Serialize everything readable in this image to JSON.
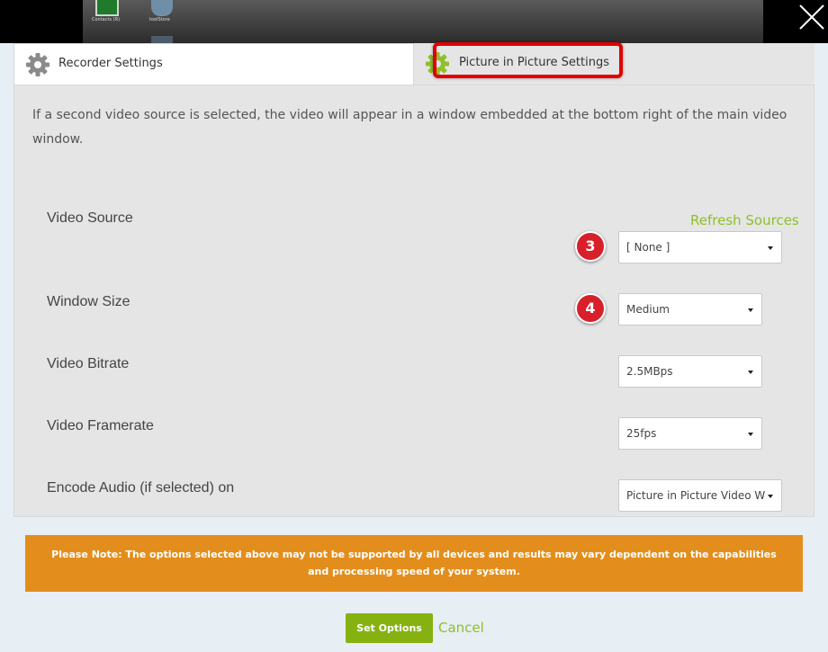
{
  "close_icon": "close-icon",
  "background": {
    "icons": [
      {
        "name": "green-app-icon",
        "caption": "Contacts (R)"
      },
      {
        "name": "cloud-app-icon",
        "caption": "toolStore"
      }
    ]
  },
  "tabs": [
    {
      "label": "Recorder Settings",
      "icon": "gear-icon",
      "active": true
    },
    {
      "label": "Picture in Picture Settings",
      "icon": "gear-icon",
      "active": false,
      "highlighted": true
    }
  ],
  "intro": "If a second video source is selected, the video will appear in a window embedded at the bottom right of the main video window.",
  "refresh_label": "Refresh Sources",
  "fields": [
    {
      "label": "Video Source",
      "value": "[ None ]",
      "marker": "3"
    },
    {
      "label": "Window Size",
      "value": "Medium",
      "marker": "4"
    },
    {
      "label": "Video Bitrate",
      "value": "2.5MBps"
    },
    {
      "label": "Video Framerate",
      "value": "25fps"
    },
    {
      "label": "Encode Audio (if selected) on",
      "value": "Picture in Picture Video W"
    }
  ],
  "note": "Please Note: The options selected above may not be supported by all devices and results may vary dependent on the capabilities and processing speed of your system.",
  "buttons": {
    "set_options": "Set Options",
    "cancel": "Cancel"
  },
  "colors": {
    "accent": "#8fbf2a",
    "button": "#86b211",
    "note_bg": "#e38e1c",
    "highlight": "#e00000",
    "marker": "#d8202a"
  }
}
